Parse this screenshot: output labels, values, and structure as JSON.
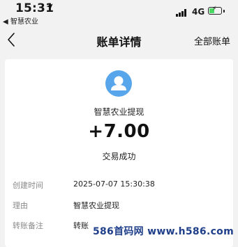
{
  "status_bar": {
    "time": "15:31",
    "back_app": "◀ 智慧农业",
    "network": "4G"
  },
  "nav": {
    "title": "账单详情",
    "right_action": "全部账单"
  },
  "transaction": {
    "merchant": "智慧农业提现",
    "amount": "+7.00",
    "status": "交易成功",
    "details": [
      {
        "label": "创建时间",
        "value": "2025-07-07 15:30:38"
      },
      {
        "label": "理由",
        "value": "智慧农业提现"
      },
      {
        "label": "转账备注",
        "value": "转账"
      }
    ]
  },
  "watermark": "586首码网 www.h586.com",
  "colors": {
    "avatar": "#57a6ec",
    "battery": "#4cd964",
    "watermark": "#1f3f8a"
  }
}
